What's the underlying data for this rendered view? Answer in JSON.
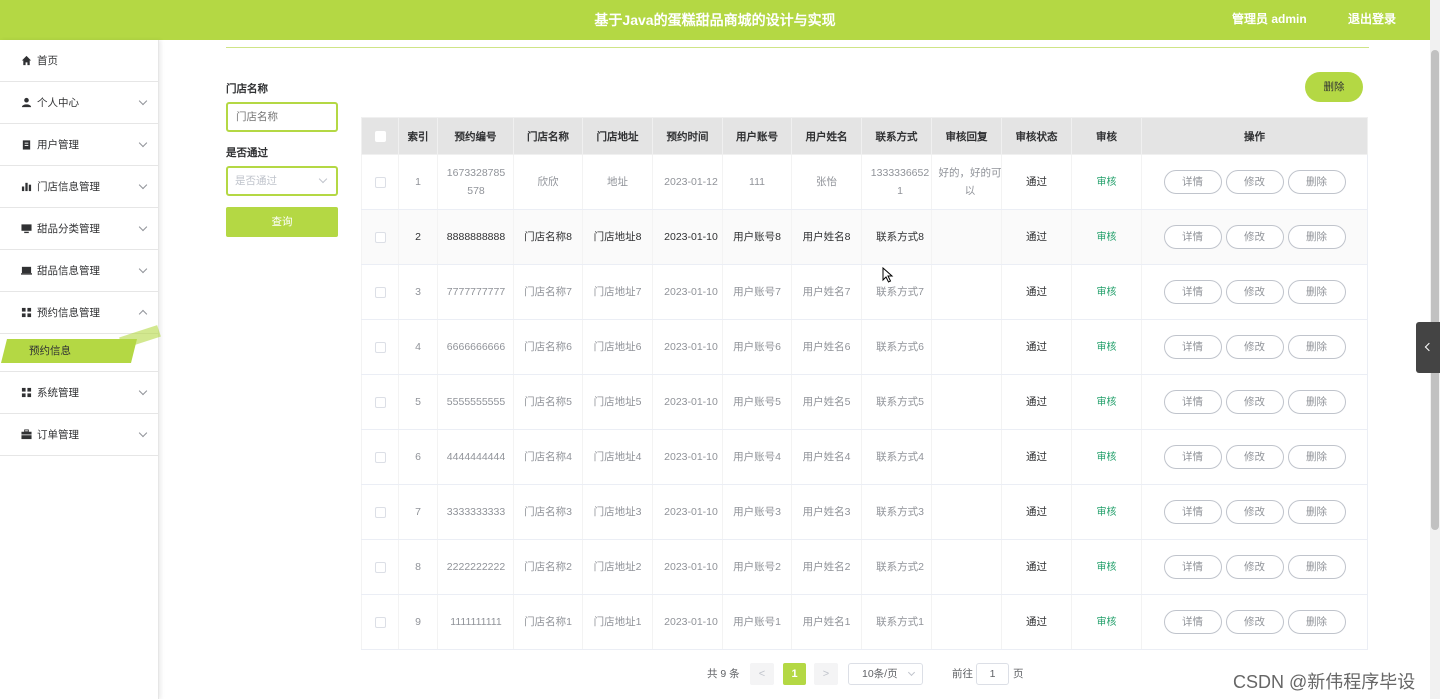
{
  "header": {
    "title": "基于Java的蛋糕甜品商城的设计与实现",
    "user": "管理员 admin",
    "logout": "退出登录"
  },
  "sidebar": {
    "items": [
      {
        "label": "首页",
        "icon": "home-icon"
      },
      {
        "label": "个人中心",
        "icon": "user-icon"
      },
      {
        "label": "用户管理",
        "icon": "clipboard-icon"
      },
      {
        "label": "门店信息管理",
        "icon": "bar-chart-icon"
      },
      {
        "label": "甜品分类管理",
        "icon": "monitor-icon"
      },
      {
        "label": "甜品信息管理",
        "icon": "tablet-icon"
      },
      {
        "label": "预约信息管理",
        "icon": "grid-icon"
      },
      {
        "label": "系统管理",
        "icon": "grid-icon"
      },
      {
        "label": "订单管理",
        "icon": "briefcase-icon"
      }
    ],
    "active_sub": "预约信息"
  },
  "search": {
    "store_label": "门店名称",
    "store_placeholder": "门店名称",
    "pass_label": "是否通过",
    "pass_placeholder": "是否通过",
    "query_button": "查询"
  },
  "toolbar": {
    "delete_label": "删除"
  },
  "table": {
    "headers": [
      "索引",
      "预约编号",
      "门店名称",
      "门店地址",
      "预约时间",
      "用户账号",
      "用户姓名",
      "联系方式",
      "审核回复",
      "审核状态",
      "审核",
      "操作"
    ],
    "rows": [
      {
        "index": "1",
        "code": "1673328785578",
        "store": "欣欣",
        "address": "地址",
        "time": "2023-01-12",
        "account": "111",
        "name": "张怡",
        "phone": "13333366521",
        "reply": "好的，好的可以",
        "status": "通过"
      },
      {
        "index": "2",
        "code": "8888888888",
        "store": "门店名称8",
        "address": "门店地址8",
        "time": "2023-01-10",
        "account": "用户账号8",
        "name": "用户姓名8",
        "phone": "联系方式8",
        "reply": "",
        "status": "通过"
      },
      {
        "index": "3",
        "code": "7777777777",
        "store": "门店名称7",
        "address": "门店地址7",
        "time": "2023-01-10",
        "account": "用户账号7",
        "name": "用户姓名7",
        "phone": "联系方式7",
        "reply": "",
        "status": "通过"
      },
      {
        "index": "4",
        "code": "6666666666",
        "store": "门店名称6",
        "address": "门店地址6",
        "time": "2023-01-10",
        "account": "用户账号6",
        "name": "用户姓名6",
        "phone": "联系方式6",
        "reply": "",
        "status": "通过"
      },
      {
        "index": "5",
        "code": "5555555555",
        "store": "门店名称5",
        "address": "门店地址5",
        "time": "2023-01-10",
        "account": "用户账号5",
        "name": "用户姓名5",
        "phone": "联系方式5",
        "reply": "",
        "status": "通过"
      },
      {
        "index": "6",
        "code": "4444444444",
        "store": "门店名称4",
        "address": "门店地址4",
        "time": "2023-01-10",
        "account": "用户账号4",
        "name": "用户姓名4",
        "phone": "联系方式4",
        "reply": "",
        "status": "通过"
      },
      {
        "index": "7",
        "code": "3333333333",
        "store": "门店名称3",
        "address": "门店地址3",
        "time": "2023-01-10",
        "account": "用户账号3",
        "name": "用户姓名3",
        "phone": "联系方式3",
        "reply": "",
        "status": "通过"
      },
      {
        "index": "8",
        "code": "2222222222",
        "store": "门店名称2",
        "address": "门店地址2",
        "time": "2023-01-10",
        "account": "用户账号2",
        "name": "用户姓名2",
        "phone": "联系方式2",
        "reply": "",
        "status": "通过"
      },
      {
        "index": "9",
        "code": "1111111111",
        "store": "门店名称1",
        "address": "门店地址1",
        "time": "2023-01-10",
        "account": "用户账号1",
        "name": "用户姓名1",
        "phone": "联系方式1",
        "reply": "",
        "status": "通过"
      }
    ],
    "audit_link": "审核",
    "ops": {
      "detail": "详情",
      "edit": "修改",
      "delete": "删除"
    }
  },
  "pagination": {
    "total": "共 9 条",
    "prev": "<",
    "current": "1",
    "next": ">",
    "page_size": "10条/页",
    "goto_label": "前往",
    "goto_value": "1",
    "page_unit": "页"
  },
  "watermark": "CSDN @新伟程序毕设",
  "colors": {
    "accent": "#b4d844",
    "audit_link": "#23a06b"
  }
}
